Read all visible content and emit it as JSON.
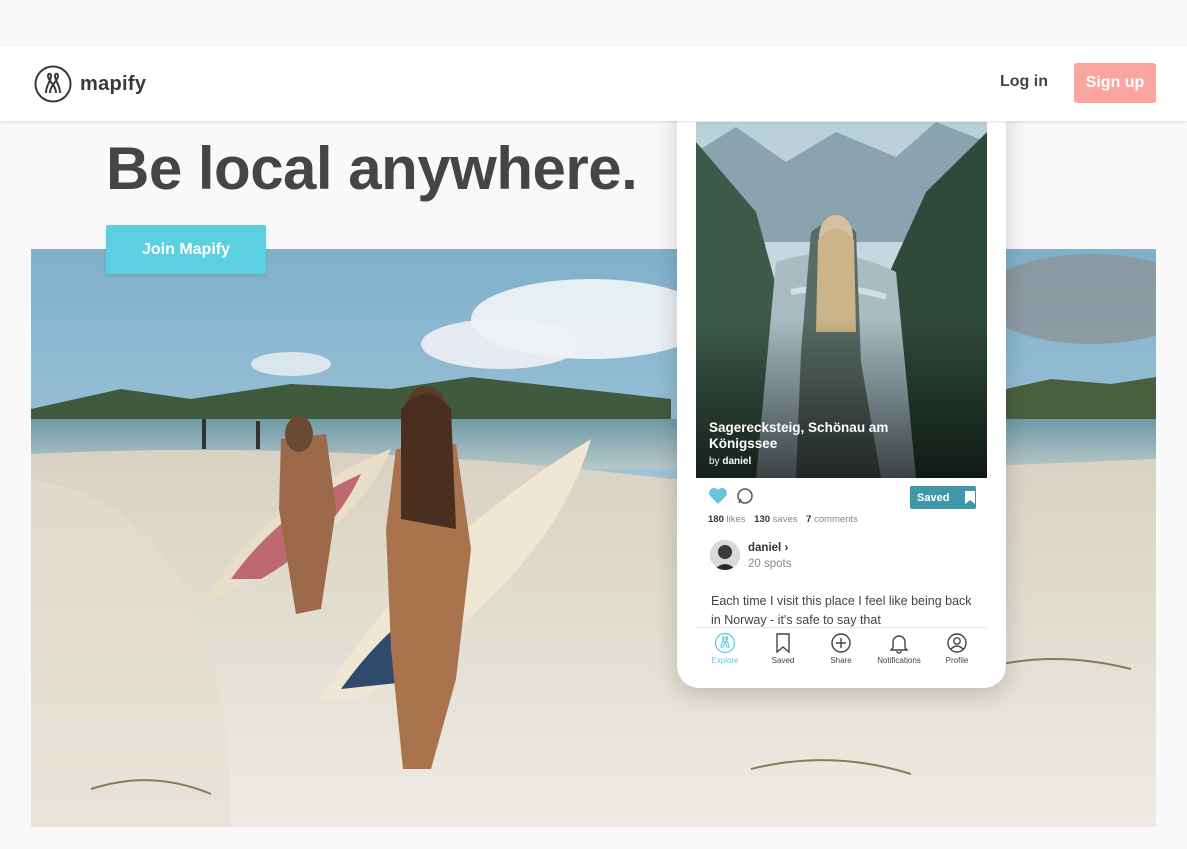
{
  "header": {
    "brand": "mapify",
    "login_label": "Log in",
    "signup_label": "Sign up"
  },
  "hero": {
    "headline": "Be local anywhere.",
    "cta_label": "Join Mapify"
  },
  "phone": {
    "spot_title": "Sagerecksteig, Schönau am Königssee",
    "by_prefix": "by",
    "by_author": "daniel",
    "saved_label": "Saved",
    "stats": {
      "likes_count": "180",
      "likes_label": "likes",
      "saves_count": "130",
      "saves_label": "saves",
      "comments_count": "7",
      "comments_label": "comments"
    },
    "author": {
      "name": "daniel",
      "chevron": "›",
      "spots": "20 spots"
    },
    "description": "Each time I visit this place I feel like being back in Norway - it's safe to say that",
    "tabs": [
      {
        "label": "Explore",
        "icon": "mapify-logo-icon"
      },
      {
        "label": "Saved",
        "icon": "bookmark-icon"
      },
      {
        "label": "Share",
        "icon": "plus-circle-icon"
      },
      {
        "label": "Notifications",
        "icon": "bell-icon"
      },
      {
        "label": "Profile",
        "icon": "user-circle-icon"
      }
    ]
  },
  "colors": {
    "accent": "#5ccfe0",
    "signup": "#fca4a0",
    "saved": "#3f98a8",
    "text": "#454545"
  }
}
